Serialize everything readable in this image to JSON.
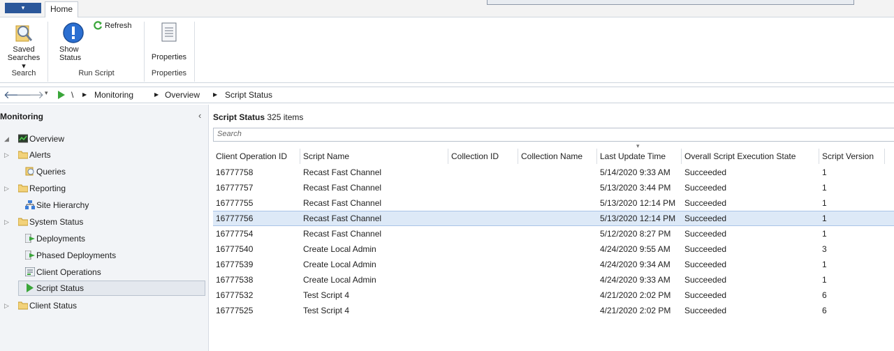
{
  "ribbon": {
    "app_menu_label": "▾",
    "tab_home": "Home",
    "saved_searches": "Saved Searches ▾",
    "show_status": "Show Status",
    "refresh": "Refresh",
    "properties": "Properties",
    "groups": [
      "Search",
      "Run Script",
      "Properties"
    ]
  },
  "address": {
    "root": "\\",
    "crumbs": [
      "Monitoring",
      "Overview",
      "Script Status"
    ]
  },
  "left_pane": {
    "title": "Monitoring",
    "collapse_glyph": "‹",
    "items": [
      {
        "label": "Overview",
        "icon": "overview-icon"
      },
      {
        "label": "Alerts",
        "icon": "folder-icon"
      },
      {
        "label": "Queries",
        "icon": "queries-icon"
      },
      {
        "label": "Reporting",
        "icon": "folder-icon"
      },
      {
        "label": "Site Hierarchy",
        "icon": "site-hierarchy-icon"
      },
      {
        "label": "System Status",
        "icon": "folder-icon"
      },
      {
        "label": "Deployments",
        "icon": "deployments-icon"
      },
      {
        "label": "Phased Deployments",
        "icon": "phased-deployments-icon"
      },
      {
        "label": "Client Operations",
        "icon": "client-operations-icon"
      },
      {
        "label": "Script Status",
        "icon": "script-status-icon"
      },
      {
        "label": "Client Status",
        "icon": "folder-icon"
      }
    ]
  },
  "main": {
    "title": "Script Status",
    "count": "325 items",
    "search_placeholder": "Search",
    "sort_glyph": "▾",
    "columns": [
      "Client Operation ID",
      "Script Name",
      "Collection ID",
      "Collection Name",
      "Last Update Time",
      "Overall Script Execution State",
      "Script Version"
    ],
    "rows": [
      [
        "16777758",
        "Recast Fast Channel",
        "",
        "",
        "5/14/2020 9:33 AM",
        "Succeeded",
        "1"
      ],
      [
        "16777757",
        "Recast Fast Channel",
        "",
        "",
        "5/13/2020 3:44 PM",
        "Succeeded",
        "1"
      ],
      [
        "16777755",
        "Recast Fast Channel",
        "",
        "",
        "5/13/2020 12:14 PM",
        "Succeeded",
        "1"
      ],
      [
        "16777756",
        "Recast Fast Channel",
        "",
        "",
        "5/13/2020 12:14 PM",
        "Succeeded",
        "1"
      ],
      [
        "16777754",
        "Recast Fast Channel",
        "",
        "",
        "5/12/2020 8:27 PM",
        "Succeeded",
        "1"
      ],
      [
        "16777540",
        "Create Local Admin",
        "",
        "",
        "4/24/2020 9:55 AM",
        "Succeeded",
        "3"
      ],
      [
        "16777539",
        "Create Local Admin",
        "",
        "",
        "4/24/2020 9:34 AM",
        "Succeeded",
        "1"
      ],
      [
        "16777538",
        "Create Local Admin",
        "",
        "",
        "4/24/2020 9:33 AM",
        "Succeeded",
        "1"
      ],
      [
        "16777532",
        "Test Script 4",
        "",
        "",
        "4/21/2020 2:02 PM",
        "Succeeded",
        "6"
      ],
      [
        "16777525",
        "Test Script 4",
        "",
        "",
        "4/21/2020 2:02 PM",
        "Succeeded",
        "6"
      ]
    ]
  },
  "colors": {
    "accent": "#2b579a",
    "selection": "#dde9f7",
    "folder": "#e8c55a",
    "script_green": "#3aa63a"
  }
}
